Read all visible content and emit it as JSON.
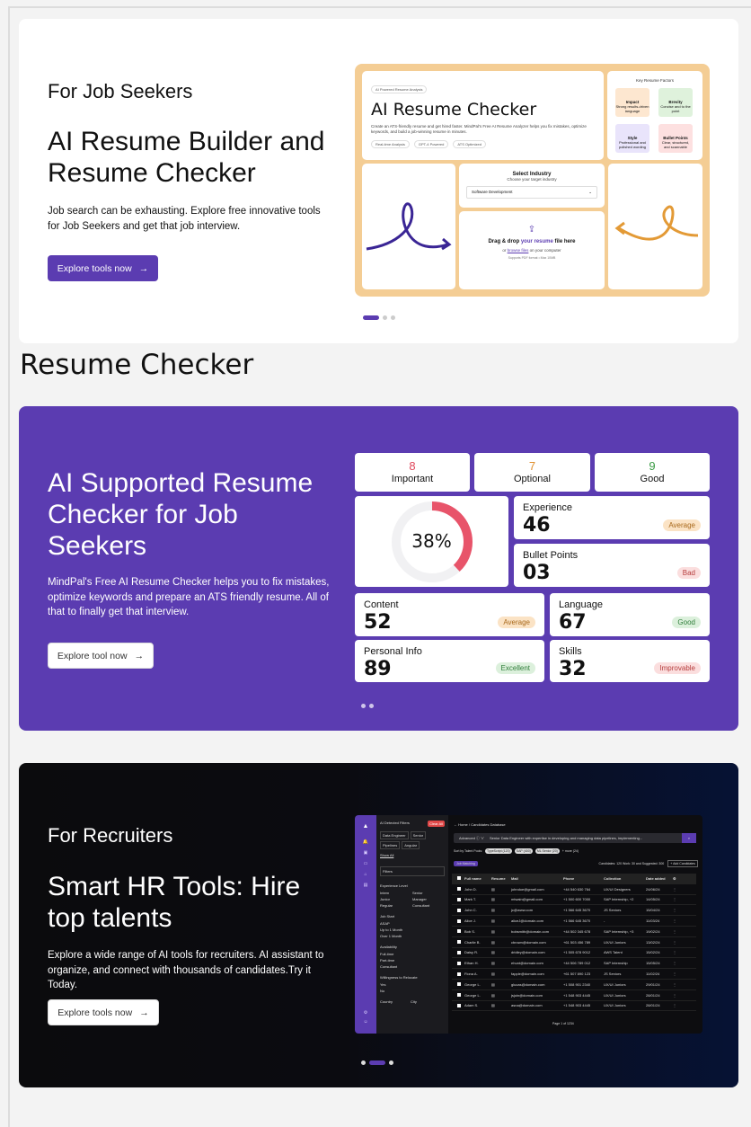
{
  "card1": {
    "eyebrow": "For Job Seekers",
    "headline": "AI Resume Builder and Resume Checker",
    "desc": "Job search can be exhausting. Explore free innovative tools for Job Seekers and get that job interview.",
    "button": "Explore tools now",
    "mock": {
      "tag": "AI Powered Resume Analysis",
      "title": "AI Resume Checker",
      "body": "Create an ATS-friendly resume and get hired faster. MindPal's Free AI Resume Analyzer helps you fix mistakes, optimize keywords, and build a job-winning resume in minutes.",
      "chips": [
        "Real-time Analysis",
        "GPT-4 Powered",
        "ATS Optimized"
      ],
      "factors_title": "Key Resume Factors",
      "factors": [
        {
          "name": "Impact",
          "desc": "Strong results-driven language",
          "bg": "#fde7d0"
        },
        {
          "name": "Brevity",
          "desc": "Concise and to the point",
          "bg": "#dff2dc"
        },
        {
          "name": "Style",
          "desc": "Professional and polished wording",
          "bg": "#e9e4fb"
        },
        {
          "name": "Bullet Points",
          "desc": "Clear, structured, and scannable",
          "bg": "#fde0e0"
        }
      ],
      "industry_title": "Select Industry",
      "industry_sub": "Choose your target industry",
      "industry_value": "Software Development",
      "drop_a": "Drag & drop ",
      "drop_b": "your resume",
      "drop_c": " file here",
      "browse_pre": "or ",
      "browse": "browse files",
      "browse_post": " on your computer",
      "supports": "Supports PDF format • Max 10MB"
    }
  },
  "section_title": "Resume Checker",
  "card2": {
    "headline": "AI Supported Resume Checker for Job Seekers",
    "desc": "MindPal's Free AI Resume Checker helps you to fix mistakes, optimize keywords and prepare an ATS friendly resume. All of that to finally get that interview.",
    "button": "Explore tool now",
    "counts": [
      {
        "n": "8",
        "t": "Important",
        "c": "#e0475b"
      },
      {
        "n": "7",
        "t": "Optional",
        "c": "#e0902f"
      },
      {
        "n": "9",
        "t": "Good",
        "c": "#3a9b45"
      }
    ],
    "score": "38%",
    "score_fraction": 0.38,
    "stats": [
      {
        "label": "Experience",
        "value": "46",
        "badge": "Average"
      },
      {
        "label": "Bullet Points",
        "value": "03",
        "badge": "Bad"
      },
      {
        "label": "Content",
        "value": "52",
        "badge": "Average"
      },
      {
        "label": "Language",
        "value": "67",
        "badge": "Good"
      },
      {
        "label": "Personal Info",
        "value": "89",
        "badge": "Excellent"
      },
      {
        "label": "Skills",
        "value": "32",
        "badge": "Improvable"
      }
    ]
  },
  "card3": {
    "eyebrow": "For Recruiters",
    "headline": "Smart HR Tools: Hire top talents",
    "desc": "Explore a wide range of AI tools for recruiters. AI assistant to organize, and connect with thousands of candidates.Try it Today.",
    "button": "Explore tools now",
    "mock": {
      "filters_title": "AI Detected Filters",
      "clear": "Clear All",
      "filter_tags": [
        "Data Engineer",
        "Senior",
        "Pipelines",
        "Angular"
      ],
      "show_all": "Show All",
      "filters": "Filters",
      "exp_level": "Experience Level",
      "exp_opts": [
        "Intern",
        "Junior",
        "Regular",
        "Senior",
        "Manager",
        "Consultant"
      ],
      "job_start": "Job Start",
      "start_opts": [
        "ASAP",
        "Up to 1 Month",
        "Over 1 Month"
      ],
      "availability": "Availability",
      "avail_opts": [
        "Full-time",
        "Part-time",
        "Consultant"
      ],
      "relocate": "Willingness to Relocate",
      "reloc_opts": [
        "Yes",
        "No"
      ],
      "country": "Country",
      "city": "City",
      "breadcrumb": "← Home / Candidates Database",
      "advanced": "Advanced ⓘ ∨",
      "query": "Senior Data Engineer with expertise in developing and managing data pipelines, implementing...",
      "sort_pre": "Sort by Talent Pools:",
      "pools": [
        "TypeScript (120)",
        "SAP (400)",
        "ML Senior (20)"
      ],
      "more": "+ more (24)",
      "job_matching": "Job Matching",
      "candidates_info": "Candidates: 120  Work: 30  and  Suggested: 300",
      "add": "+ Add Candidates",
      "headers": [
        "Full name",
        "Resume",
        "Mail",
        "Phone",
        "Collection",
        "Date added"
      ],
      "rows": [
        [
          "John D.",
          "johndoe@gmail.com",
          "+44 540 630 764",
          "UX/UI Designers",
          "24/06/24"
        ],
        [
          "Mark T.",
          "mtwain@gmail.com",
          "+1 500 600 7000",
          "SAP Internship, +2",
          "14/05/24"
        ],
        [
          "John C.",
          "jc@www.com",
          "+1 566 645 3670",
          "JS Seniors",
          "15/04/24"
        ],
        [
          "Alice J.",
          "aliceJ@domain.com",
          "+1 566 645 3670",
          "-",
          "11/03/24"
        ],
        [
          "Bob S.",
          "bobsmith@domain.com",
          "+44 502 345 678",
          "SAP Internship, +3",
          "19/02/24"
        ],
        [
          "Charlie B.",
          "cbrown@domain.com",
          "+61 503 456 789",
          "UX/UI Juniors",
          "13/02/24"
        ],
        [
          "Daisy R.",
          "dridley@domain.com",
          "+1 505 678 9012",
          "AWS Talent",
          "15/02/24"
        ],
        [
          "Ethan H.",
          "ehunt@domain.com",
          "+44 506 789 012",
          "SAP Internship",
          "15/05/24"
        ],
        [
          "Fiona A.",
          "fapple@domain.com",
          "+61 507 890 123",
          "JS Seniors",
          "11/02/24"
        ],
        [
          "George L.",
          "glucas@domain.com",
          "+1 508 901 2340",
          "UX/UI Juniors",
          "29/01/24"
        ],
        [
          "George L.",
          "jsjoin@domain.com",
          "+1 548 903 4445",
          "UX/UI Juniors",
          "28/01/24"
        ],
        [
          "Adam S.",
          "asna@domain.com",
          "+1 548 903 4445",
          "UX/UI Juniors",
          "28/01/24"
        ]
      ],
      "pager": "Page 1 of 1234"
    }
  }
}
